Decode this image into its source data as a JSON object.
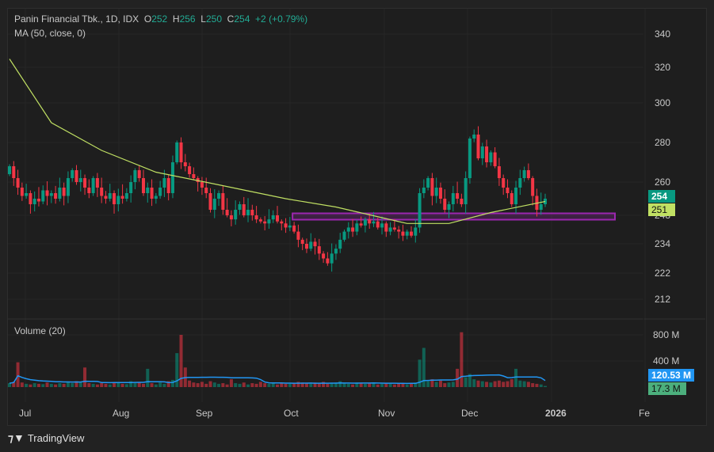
{
  "header": {
    "symbol": "Panin Financial Tbk., 1D, IDX",
    "o_label": "O",
    "o": "252",
    "h_label": "H",
    "h": "256",
    "l_label": "L",
    "l": "250",
    "c_label": "C",
    "c": "254",
    "change": "+2 (+0.79%)"
  },
  "indicator": {
    "ma_label": "MA (50, close, 0)",
    "volume_label": "Volume (20)"
  },
  "price_axis": [
    "340",
    "320",
    "300",
    "280",
    "260",
    "248",
    "234",
    "222",
    "212"
  ],
  "volume_axis": [
    "800 M",
    "400 M"
  ],
  "badges": {
    "last_price": "254",
    "ma_value": "251",
    "vol_ma": "120.53 M",
    "last_volume": "17.3 M"
  },
  "time_axis": [
    "Jul",
    "Aug",
    "Sep",
    "Oct",
    "Nov",
    "Dec",
    "2026",
    "Fe"
  ],
  "footer": {
    "brand": "TradingView"
  },
  "colors": {
    "up": "#089981",
    "down": "#f23645",
    "ma": "#c0e063",
    "zone": "#9c27b0",
    "vol_ma": "#2196f3"
  },
  "chart_data": {
    "type": "candlestick",
    "closes": [
      268,
      262,
      258,
      255,
      256,
      252,
      254,
      253,
      257,
      255,
      256,
      254,
      258,
      255,
      262,
      266,
      260,
      262,
      258,
      256,
      262,
      258,
      255,
      254,
      256,
      252,
      255,
      254,
      256,
      260,
      266,
      262,
      256,
      258,
      254,
      255,
      258,
      262,
      256,
      270,
      280,
      270,
      268,
      264,
      262,
      260,
      258,
      256,
      250,
      254,
      256,
      250,
      248,
      246,
      250,
      252,
      248,
      250,
      248,
      246,
      245,
      244,
      246,
      248,
      245,
      244,
      242,
      243,
      240,
      236,
      234,
      232,
      235,
      233,
      230,
      228,
      226,
      230,
      232,
      236,
      240,
      242,
      240,
      244,
      243,
      246,
      244,
      245,
      242,
      244,
      240,
      242,
      241,
      240,
      238,
      240,
      238,
      242,
      256,
      258,
      262,
      255,
      258,
      254,
      250,
      252,
      256,
      254,
      252,
      262,
      282,
      284,
      272,
      278,
      270,
      275,
      268,
      262,
      258,
      256,
      252,
      258,
      262,
      266,
      262,
      255,
      250,
      252,
      254
    ],
    "ma_keypoints": [
      [
        0,
        325
      ],
      [
        10,
        290
      ],
      [
        22,
        276
      ],
      [
        35,
        265
      ],
      [
        50,
        259
      ],
      [
        66,
        254
      ],
      [
        78,
        251
      ],
      [
        95,
        244
      ],
      [
        105,
        244
      ],
      [
        115,
        249
      ],
      [
        128,
        253
      ]
    ],
    "volumes_m": [
      60,
      80,
      380,
      70,
      50,
      40,
      60,
      50,
      45,
      70,
      50,
      40,
      60,
      50,
      80,
      60,
      90,
      70,
      300,
      60,
      50,
      40,
      60,
      50,
      40,
      60,
      70,
      50,
      45,
      90,
      60,
      70,
      50,
      280,
      60,
      40,
      70,
      50,
      90,
      110,
      520,
      800,
      300,
      100,
      70,
      60,
      80,
      50,
      90,
      70,
      50,
      60,
      40,
      120,
      60,
      50,
      70,
      40,
      60,
      50,
      80,
      60,
      50,
      70,
      40,
      60,
      50,
      50,
      60,
      80,
      70,
      60,
      50,
      70,
      60,
      80,
      50,
      60,
      70,
      90,
      60,
      50,
      40,
      70,
      60,
      50,
      60,
      70,
      40,
      50,
      60,
      50,
      40,
      60,
      50,
      40,
      60,
      70,
      420,
      600,
      90,
      120,
      80,
      100,
      60,
      70,
      80,
      280,
      840,
      150,
      200,
      120,
      100,
      90,
      80,
      70,
      90,
      100,
      80,
      90,
      120,
      280,
      100,
      90,
      80,
      60,
      50,
      40,
      17.3
    ],
    "zone": {
      "from": 246,
      "to": 249,
      "start_index": 68
    },
    "ylim": [
      212,
      340
    ]
  }
}
